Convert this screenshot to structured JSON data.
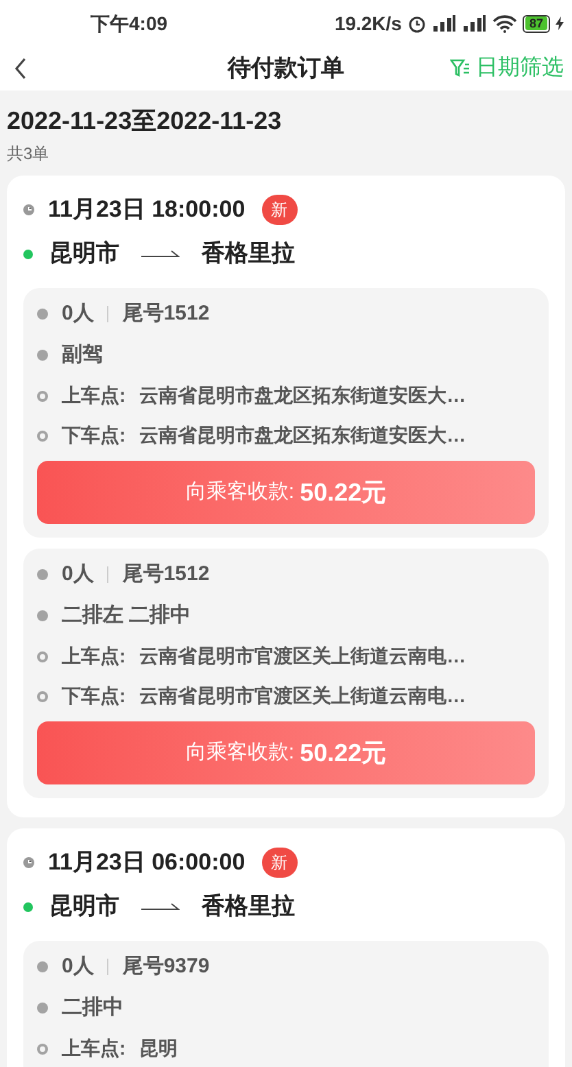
{
  "status_bar": {
    "time": "下午4:09",
    "net_speed": "19.2K/s",
    "battery": "87"
  },
  "header": {
    "title": "待付款订单",
    "filter": "日期筛选"
  },
  "range": "2022-11-23至2022-11-23",
  "count": "共3单",
  "orders": [
    {
      "time": "11月23日 18:00:00",
      "badge": "新",
      "from": "昆明市",
      "to": "香格里拉",
      "passengers": [
        {
          "count": "0人",
          "tail": "尾号1512",
          "seats": "副驾",
          "pickup_label": "上车点:",
          "pickup": "云南省昆明市盘龙区拓东街道安医大…",
          "dropoff_label": "下车点:",
          "dropoff": "云南省昆明市盘龙区拓东街道安医大…",
          "pay_label": "向乘客收款:",
          "amount": "50.22元"
        },
        {
          "count": "0人",
          "tail": "尾号1512",
          "seats": "二排左 二排中",
          "pickup_label": "上车点:",
          "pickup": "云南省昆明市官渡区关上街道云南电…",
          "dropoff_label": "下车点:",
          "dropoff": "云南省昆明市官渡区关上街道云南电…",
          "pay_label": "向乘客收款:",
          "amount": "50.22元"
        }
      ]
    },
    {
      "time": "11月23日 06:00:00",
      "badge": "新",
      "from": "昆明市",
      "to": "香格里拉",
      "passengers": [
        {
          "count": "0人",
          "tail": "尾号9379",
          "seats": "二排中",
          "pickup_label": "上车点:",
          "pickup": "昆明"
        }
      ]
    }
  ]
}
